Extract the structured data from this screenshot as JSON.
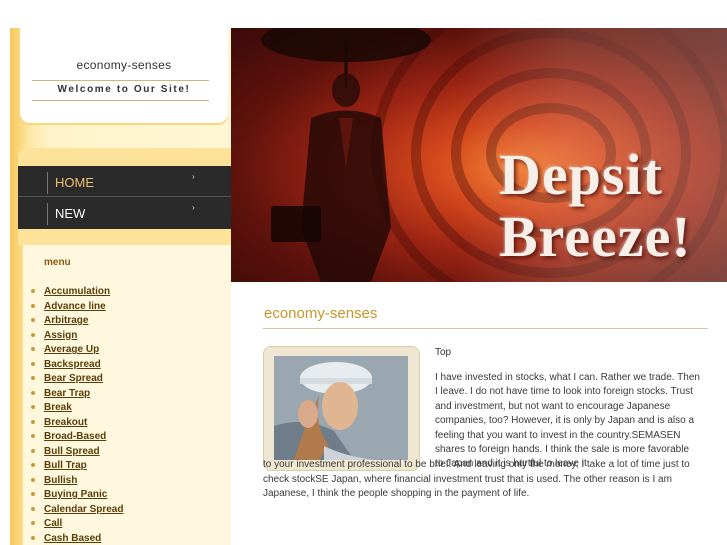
{
  "site": {
    "name": "economy-senses",
    "welcome": "Welcome to Our Site!"
  },
  "nav": [
    {
      "label": "HOME",
      "arrow": "›"
    },
    {
      "label": "NEW",
      "arrow": "›"
    }
  ],
  "menu": {
    "title": "menu",
    "items": [
      "Accumulation",
      "Advance line",
      "Arbitrage",
      "Assign",
      "Average Up",
      "Backspread",
      "Bear Spread",
      "Bear Trap",
      "Break",
      "Breakout",
      "Broad-Based",
      "Bull Spread",
      "Bull Trap",
      "Bullish",
      "Buying Panic",
      "Calendar Spread",
      "Call",
      "Cash Based"
    ]
  },
  "hero": {
    "line1": "Depsit",
    "line2": "Breeze!"
  },
  "content": {
    "title": "economy-senses",
    "top_link": "Top",
    "paragraph_part1": "I have invested in stocks, what I can. Rather we trade. Then I leave. I do not have time to look into foreign stocks. Trust and investment, but not want to encourage Japanese companies, too? However, it is only by Japan and is also a feeling that you want to invest in the country.SEMASEN shares to foreign hands. I think the sale is more favorable to Japan and it is hurtful to leave it",
    "paragraph_part2": "to your investment professional to be brief. And leaving only the money, I take a lot of time just to check stockSE Japan, where financial investment trust that is used. The other reason is I am Japanese, I think the people shopping in the payment of life."
  },
  "colors": {
    "accent_gold": "#c8962a",
    "nav_dark": "#2a2a2a",
    "nav_active": "#f2c16e",
    "menu_link": "#5a3e0a"
  }
}
